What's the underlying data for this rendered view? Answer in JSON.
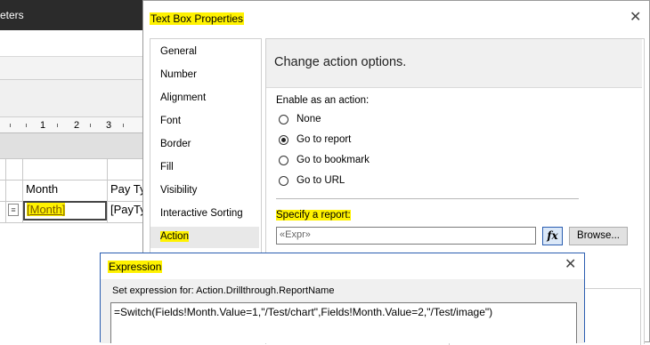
{
  "background": {
    "titlebar_text": "eters",
    "ruler_labels": [
      "1",
      "2",
      "3"
    ],
    "table": {
      "headers": [
        "Month",
        "Pay Ty"
      ],
      "row": [
        "[Month]",
        "[PayTy"
      ]
    }
  },
  "text_box_properties": {
    "title": "Text Box Properties",
    "close_glyph": "✕",
    "nav_items": [
      {
        "label": "General"
      },
      {
        "label": "Number"
      },
      {
        "label": "Alignment"
      },
      {
        "label": "Font"
      },
      {
        "label": "Border"
      },
      {
        "label": "Fill"
      },
      {
        "label": "Visibility"
      },
      {
        "label": "Interactive Sorting"
      },
      {
        "label": "Action"
      }
    ],
    "selected_nav": "Action",
    "content": {
      "header": "Change action options.",
      "enable_label": "Enable as an action:",
      "options": [
        {
          "label": "None",
          "checked": false
        },
        {
          "label": "Go to report",
          "checked": true
        },
        {
          "label": "Go to bookmark",
          "checked": false
        },
        {
          "label": "Go to URL",
          "checked": false
        }
      ],
      "specify_label": "Specify a report:",
      "report_placeholder": "«Expr»",
      "fx_label": "fx",
      "browse_label": "Browse..."
    }
  },
  "expression_dialog": {
    "title": "Expression",
    "close_glyph": "✕",
    "set_for_label": "Set expression for: Action.Drillthrough.ReportName",
    "expression_text": "=Switch(Fields!Month.Value=1,\"/Test/chart\",Fields!Month.Value=2,\"/Test/image\")"
  },
  "highlight_color": "#fff200"
}
